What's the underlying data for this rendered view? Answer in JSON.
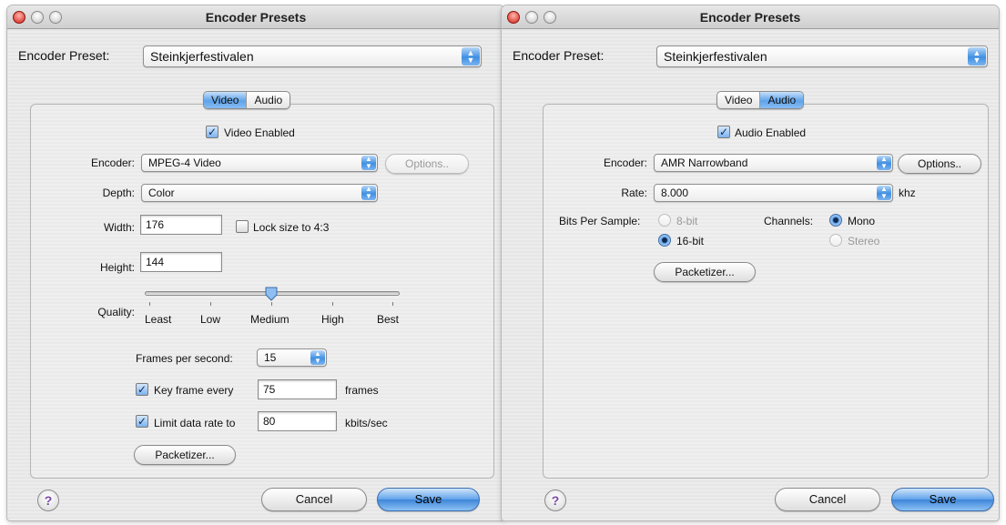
{
  "window_title": "Encoder Presets",
  "preset_label": "Encoder Preset:",
  "preset_value": "Steinkjerfestivalen",
  "tabs": [
    "Video",
    "Audio"
  ],
  "help_label": "?",
  "cancel_label": "Cancel",
  "save_label": "Save",
  "video": {
    "enabled_label": "Video Enabled",
    "enabled": true,
    "encoder_label": "Encoder:",
    "encoder_value": "MPEG-4 Video",
    "options_label": "Options..",
    "depth_label": "Depth:",
    "depth_value": "Color",
    "width_label": "Width:",
    "width_value": "176",
    "lock_label": "Lock size to 4:3",
    "lock_checked": false,
    "height_label": "Height:",
    "height_value": "144",
    "quality_label": "Quality:",
    "quality_marks": [
      "Least",
      "Low",
      "Medium",
      "High",
      "Best"
    ],
    "quality_level": 0.5,
    "fps_label": "Frames per second:",
    "fps_value": "15",
    "keyframe_label": "Key frame every",
    "keyframe_checked": true,
    "keyframe_value": "75",
    "keyframe_unit": "frames",
    "limit_label": "Limit data rate to",
    "limit_checked": true,
    "limit_value": "80",
    "limit_unit": "kbits/sec",
    "packetizer_label": "Packetizer..."
  },
  "audio": {
    "enabled_label": "Audio Enabled",
    "enabled": true,
    "encoder_label": "Encoder:",
    "encoder_value": "AMR Narrowband",
    "options_label": "Options..",
    "rate_label": "Rate:",
    "rate_value": "8.000",
    "rate_unit": "khz",
    "bits_label": "Bits Per Sample:",
    "bits_8": "8-bit",
    "bits_16": "16-bit",
    "channels_label": "Channels:",
    "mono": "Mono",
    "stereo": "Stereo",
    "packetizer_label": "Packetizer..."
  },
  "colors": {
    "accent_blue": "#5fa2ea",
    "close_red": "#d11f13",
    "panel_bg": "#e9e9e9",
    "disabled_text": "#9a9a9a"
  }
}
